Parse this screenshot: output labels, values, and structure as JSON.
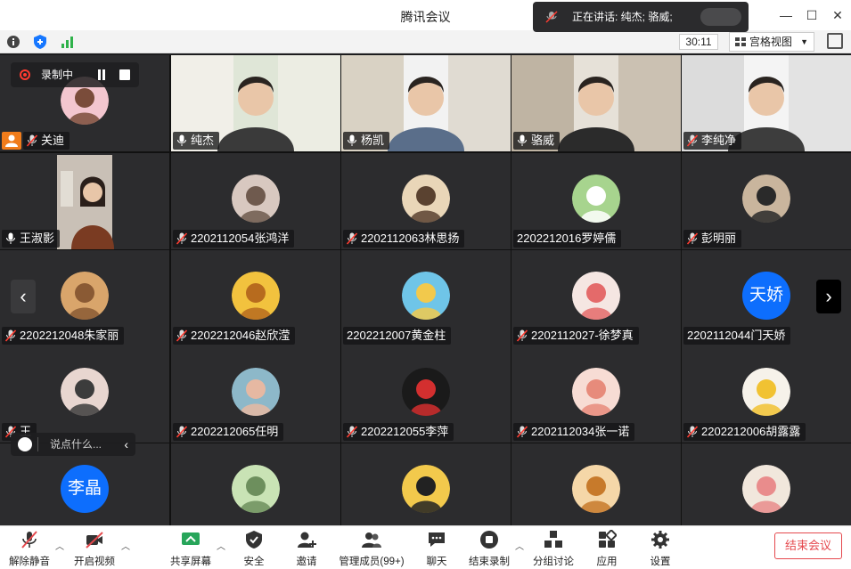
{
  "window": {
    "title": "腾讯会议",
    "min": "—",
    "max": "☐",
    "close": "✕"
  },
  "speaking": {
    "text": "正在讲话: 纯杰; 骆威;"
  },
  "timer": "30:11",
  "view_label": "宫格视图",
  "recording": {
    "label": "录制中"
  },
  "chat": {
    "placeholder": "说点什么..."
  },
  "tiles": [
    {
      "name": "关迪",
      "muted": true
    },
    {
      "name": "纯杰",
      "muted": false,
      "active": true
    },
    {
      "name": "杨凯",
      "muted": false
    },
    {
      "name": "骆威",
      "muted": false
    },
    {
      "name": "李纯净",
      "muted": true
    },
    {
      "name": "王淑影",
      "muted": false
    },
    {
      "name": "2202112054张鸿洋",
      "muted": true
    },
    {
      "name": "2202112063林思扬",
      "muted": true
    },
    {
      "name": "2202212016罗婷儒",
      "muted": null
    },
    {
      "name": "彭明丽",
      "muted": true
    },
    {
      "name": "2202212048朱家丽",
      "muted": true
    },
    {
      "name": "2202212046赵欣滢",
      "muted": true
    },
    {
      "name": "2202212007黄金柱",
      "muted": null
    },
    {
      "name": "2202112027-徐梦真",
      "muted": true
    },
    {
      "name": "2202112044门天娇",
      "muted": null,
      "initials": "天娇"
    },
    {
      "name": "王",
      "muted": true
    },
    {
      "name": "2202212065任明",
      "muted": true
    },
    {
      "name": "2202212055李萍",
      "muted": true
    },
    {
      "name": "2202112034张一诺",
      "muted": true
    },
    {
      "name": "2202212006胡露露",
      "muted": true
    },
    {
      "name": "",
      "muted": null,
      "initials": "李晶"
    },
    {
      "name": "",
      "muted": null
    },
    {
      "name": "",
      "muted": null
    },
    {
      "name": "",
      "muted": null
    },
    {
      "name": "",
      "muted": null
    }
  ],
  "toolbar": {
    "unmute": "解除静音",
    "start_video": "开启视频",
    "share": "共享屏幕",
    "security": "安全",
    "invite": "邀请",
    "members": "管理成员(99+)",
    "chat": "聊天",
    "stop_rec": "结束录制",
    "breakout": "分组讨论",
    "apps": "应用",
    "settings": "设置",
    "end": "结束会议"
  },
  "colors": {
    "accent": "#0d6efd",
    "active_border": "#35c26b",
    "end": "#e5484d",
    "record": "#ff3b30"
  }
}
